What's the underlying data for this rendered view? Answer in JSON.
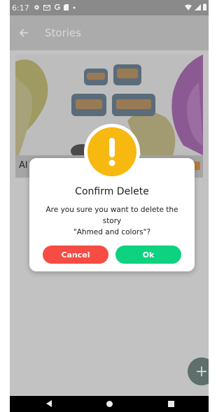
{
  "status_bar": {
    "time": "6:17",
    "left_icons": [
      "settings-icon",
      "mail-icon",
      "google-icon",
      "sd-card-icon",
      "dot-icon"
    ],
    "right_icons": [
      "wifi-icon",
      "signal-icon",
      "battery-icon"
    ]
  },
  "app_bar": {
    "title": "Stories",
    "back_icon": "arrow-left-icon"
  },
  "story_card": {
    "caption_visible": "Al"
  },
  "dialog": {
    "icon": "exclamation-icon",
    "title": "Confirm Delete",
    "message_line1": "Are you sure you want to delete the story",
    "message_line2": "\"Ahmed and colors\"?",
    "cancel_label": "Cancel",
    "ok_label": "Ok",
    "colors": {
      "warning": "#f7b80f",
      "cancel": "#f64c43",
      "ok": "#0dd27f"
    }
  },
  "fab": {
    "label": "+",
    "icon": "plus-icon"
  },
  "nav_bar": {
    "icons": [
      "back-triangle-icon",
      "home-circle-icon",
      "recents-square-icon"
    ]
  }
}
